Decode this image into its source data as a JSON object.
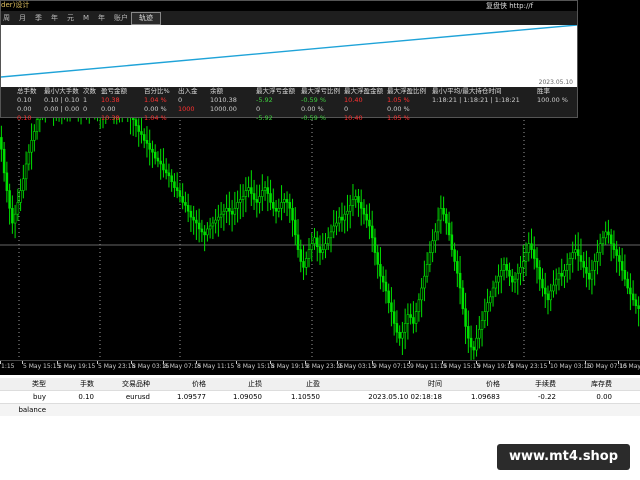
{
  "window": {
    "title_fragment": "der)设计",
    "url_fragment": "复盘侠 http://f"
  },
  "menu": [
    "周",
    "月",
    "季",
    "年",
    "元",
    "M",
    "年",
    "账户"
  ],
  "toolbar": {
    "track_button": "轨迹"
  },
  "equity_plot": {
    "date_label": "2023.05.10",
    "line_color": "#1fa3d8"
  },
  "stats": {
    "headers": [
      "总手数",
      "最小/大手数",
      "次数",
      "盈亏金额",
      "百分比%",
      "出入金",
      "余额",
      "最大浮亏金额",
      "最大浮亏比例",
      "最大浮盈金额",
      "最大浮盈比例",
      "最小/平均/最大持仓时间",
      "胜率"
    ],
    "row1": [
      "0.10",
      "0.10 | 0.10",
      "1",
      "10.38",
      "1.04 %",
      "0",
      "1010.38",
      "-5.92",
      "-0.59 %",
      "10.40",
      "1.05 %",
      "1:18:21 | 1:18:21 | 1:18:21",
      "100.00 %"
    ],
    "row2": [
      "0.00",
      "0.00 | 0.00",
      "0",
      "0.00",
      "0.00 %",
      "1000",
      "1000.00",
      "0",
      "0.00 %",
      "0",
      "0.00 %",
      "",
      ""
    ],
    "row3": [
      "0.10",
      "",
      "",
      "10.38",
      "1.04 %",
      "",
      "",
      "-5.92",
      "-0.59 %",
      "10.40",
      "1.05 %",
      "",
      ""
    ]
  },
  "time_axis": [
    "1:15",
    "5 May 15:15",
    "5 May 19:15",
    "5 May 23:15",
    "8 May 03:15",
    "8 May 07:15",
    "8 May 11:15",
    "8 May 15:15",
    "8 May 19:15",
    "8 May 23:15",
    "9 May 03:15",
    "9 May 07:15",
    "9 May 11:15",
    "9 May 15:15",
    "9 May 19:15",
    "9 May 23:15",
    "10 May 03:15",
    "10 May 07:15",
    "10 May 11:15"
  ],
  "orders": {
    "headers": [
      "类型",
      "手数",
      "交易品种",
      "价格",
      "止损",
      "止盈",
      "时间",
      "价格",
      "手续费",
      "库存费"
    ],
    "row": [
      "buy",
      "0.10",
      "eurusd",
      "1.09577",
      "1.09050",
      "1.10550",
      "2023.05.10 02:18:18",
      "1.09683",
      "-0.22",
      "0.00"
    ],
    "balance_label": "balance"
  },
  "watermark": "www.mt4.shop",
  "colors": {
    "candle_bull": "#00e000",
    "chart_bg": "#000000",
    "grid": "#9a9a9a"
  },
  "series": {
    "closes": [
      1.098,
      1.0972,
      1.0966,
      1.096,
      1.0955,
      1.0958,
      1.0962,
      1.0966,
      1.097,
      1.0975,
      1.0979,
      1.0983,
      1.0986,
      1.099,
      1.0993,
      1.0995,
      1.0996,
      1.0994,
      1.0995,
      1.0993,
      1.0995,
      1.0996,
      1.0994,
      1.0993,
      1.0995,
      1.0994,
      1.0996,
      1.0995,
      1.0993,
      1.0994,
      1.0995,
      1.0994,
      1.0996,
      1.0995,
      1.0993,
      1.0992,
      1.0993,
      1.0994,
      1.0996,
      1.0995,
      1.0993,
      1.0992,
      1.0994,
      1.0995,
      1.0996,
      1.0994,
      1.0993,
      1.0991,
      1.099,
      1.0988,
      1.0986,
      1.0985,
      1.0983,
      1.0982,
      1.098,
      1.0979,
      1.0977,
      1.0976,
      1.0975,
      1.0973,
      1.0972,
      1.0971,
      1.0969,
      1.0967,
      1.0966,
      1.0964,
      1.0962,
      1.0961,
      1.0959,
      1.0957,
      1.0956,
      1.0955,
      1.0953,
      1.0952,
      1.0951,
      1.0953,
      1.0954,
      1.0955,
      1.0956,
      1.0957,
      1.0958,
      1.0959,
      1.096,
      1.0959,
      1.0958,
      1.096,
      1.0962,
      1.0963,
      1.0964,
      1.0966,
      1.0967,
      1.0965,
      1.0963,
      1.0962,
      1.0964,
      1.0966,
      1.0967,
      1.0965,
      1.0962,
      1.096,
      1.0959,
      1.096,
      1.0962,
      1.0963,
      1.0962,
      1.096,
      1.0956,
      1.0951,
      1.0946,
      1.0942,
      1.094,
      1.0943,
      1.0946,
      1.0948,
      1.095,
      1.0947,
      1.0945,
      1.0946,
      1.0948,
      1.095,
      1.0952,
      1.0954,
      1.0955,
      1.0957,
      1.0956,
      1.0958,
      1.0959,
      1.0961,
      1.0963,
      1.0964,
      1.0962,
      1.096,
      1.0958,
      1.0956,
      1.0954,
      1.095,
      1.0945,
      1.0941,
      1.0937,
      1.0935,
      1.0932,
      1.0928,
      1.0925,
      1.0921,
      1.0918,
      1.0916,
      1.0918,
      1.0921,
      1.0924,
      1.0923,
      1.0921,
      1.0925,
      1.0929,
      1.0933,
      1.0937,
      1.0941,
      1.0945,
      1.0949,
      1.0952,
      1.0956,
      1.096,
      1.0958,
      1.0955,
      1.0951,
      1.0946,
      1.0942,
      1.0938,
      1.0933,
      1.0926,
      1.092,
      1.0916,
      1.0913,
      1.0912,
      1.0916,
      1.0919,
      1.0922,
      1.0925,
      1.0928,
      1.093,
      1.0933,
      1.0935,
      1.0937,
      1.0939,
      1.0941,
      1.0939,
      1.0937,
      1.0935,
      1.0936,
      1.0938,
      1.094,
      1.0942,
      1.0945,
      1.0948,
      1.0946,
      1.0943,
      1.094,
      1.0936,
      1.0933,
      1.0931,
      1.0929,
      1.0932,
      1.0934,
      1.0936,
      1.0938,
      1.0937,
      1.0939,
      1.0941,
      1.0943,
      1.0945,
      1.0946,
      1.0944,
      1.0942,
      1.094,
      1.0938,
      1.0936,
      1.0939,
      1.0942,
      1.0945,
      1.0948,
      1.095,
      1.0952,
      1.0951,
      1.0948,
      1.0946,
      1.0944,
      1.0942,
      1.0939,
      1.0936,
      1.0933,
      1.0931,
      1.0929,
      1.0927,
      1.0926
    ]
  }
}
